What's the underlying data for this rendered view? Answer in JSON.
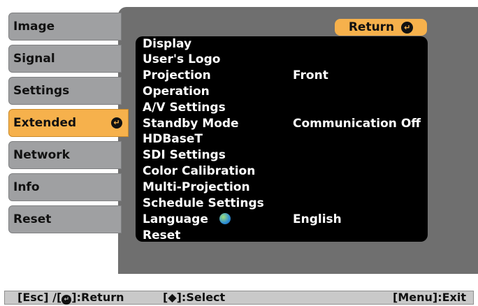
{
  "sidebar": {
    "items": [
      {
        "label": "Image"
      },
      {
        "label": "Signal"
      },
      {
        "label": "Settings"
      },
      {
        "label": "Extended"
      },
      {
        "label": "Network"
      },
      {
        "label": "Info"
      },
      {
        "label": "Reset"
      }
    ],
    "active_index": 3
  },
  "return_button": {
    "label": "Return"
  },
  "menu": {
    "rows": [
      {
        "label": "Display",
        "value": ""
      },
      {
        "label": "User's Logo",
        "value": ""
      },
      {
        "label": "Projection",
        "value": "Front"
      },
      {
        "label": "Operation",
        "value": ""
      },
      {
        "label": "A/V Settings",
        "value": ""
      },
      {
        "label": "Standby Mode",
        "value": "Communication Off"
      },
      {
        "label": "HDBaseT",
        "value": ""
      },
      {
        "label": "SDI Settings",
        "value": ""
      },
      {
        "label": "Color Calibration",
        "value": ""
      },
      {
        "label": "Multi-Projection",
        "value": ""
      },
      {
        "label": "Schedule Settings",
        "value": ""
      },
      {
        "label": "Language",
        "value": "English"
      },
      {
        "label": "Reset",
        "value": ""
      }
    ]
  },
  "bottom_bar": {
    "left_prefix": "[Esc] /[",
    "left_suffix": "]:Return",
    "middle": "[◆]:Select",
    "right": "[Menu]:Exit"
  },
  "colors": {
    "accent": "#f6b14c",
    "panel": "#6f6f6f",
    "tab": "#9fa0a2",
    "list_bg": "#000000"
  },
  "icons": {
    "enter": "enter-icon",
    "globe": "globe-icon"
  }
}
